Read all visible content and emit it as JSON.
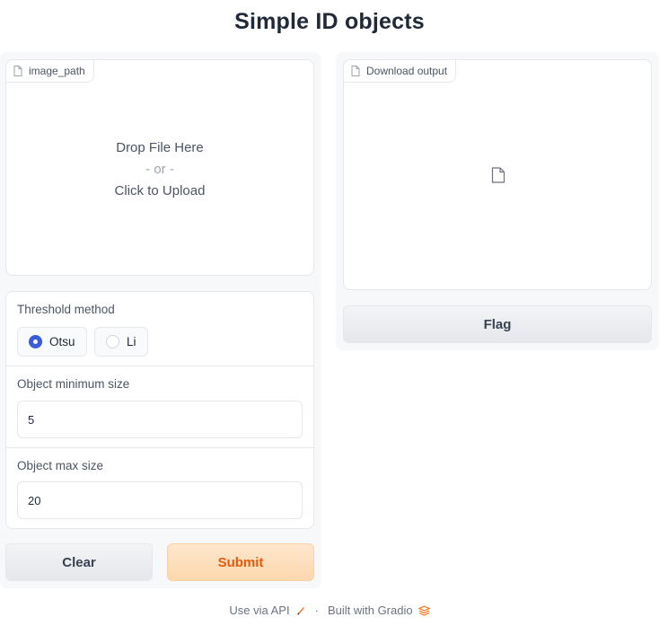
{
  "page": {
    "title": "Simple ID objects"
  },
  "upload": {
    "label": "image_path",
    "drop_text": "Drop File Here",
    "or_text": "- or -",
    "click_text": "Click to Upload"
  },
  "threshold": {
    "label": "Threshold method",
    "options": [
      {
        "label": "Otsu",
        "selected": true
      },
      {
        "label": "Li",
        "selected": false
      }
    ]
  },
  "min_size": {
    "label": "Object minimum size",
    "value": "5"
  },
  "max_size": {
    "label": "Object max size",
    "value": "20"
  },
  "buttons": {
    "clear": "Clear",
    "submit": "Submit",
    "flag": "Flag"
  },
  "download": {
    "label": "Download output"
  },
  "footer": {
    "api": "Use via API",
    "separator": "·",
    "built": "Built with Gradio"
  },
  "colors": {
    "accent": "#3b5bdb",
    "submit_text": "#ea580c",
    "submit_bg": "#fdd7ad"
  },
  "icons": {
    "file": "file-icon",
    "api": "rocket-icon",
    "gradio": "gradio-logo-icon"
  }
}
